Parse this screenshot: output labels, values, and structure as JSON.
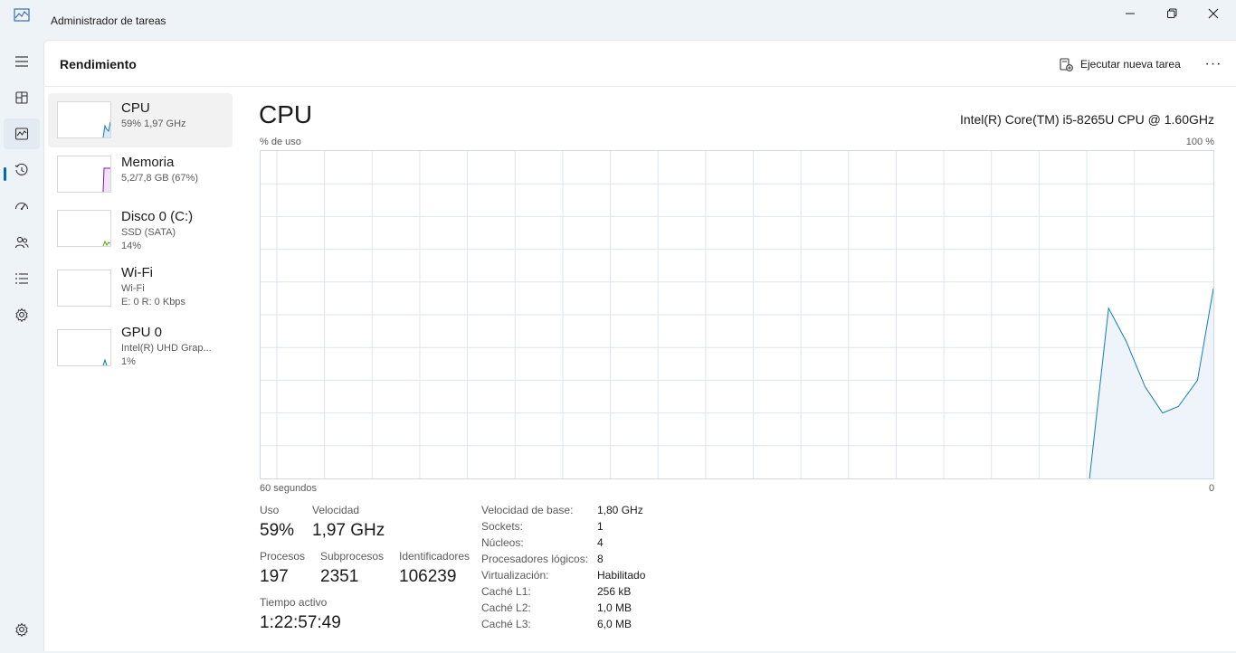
{
  "window": {
    "title": "Administrador de tareas"
  },
  "header": {
    "title": "Rendimiento",
    "run_task_label": "Ejecutar nueva tarea",
    "more_label": "···"
  },
  "nav": {
    "items": [
      "menu-icon",
      "processes-icon",
      "performance-icon",
      "history-icon",
      "startup-icon",
      "users-icon",
      "details-icon",
      "services-icon",
      "settings-icon"
    ],
    "active": "performance-icon"
  },
  "resources": [
    {
      "name": "CPU",
      "sub1": "59%  1,97 GHz",
      "sub2": "",
      "color": "#117dbb"
    },
    {
      "name": "Memoria",
      "sub1": "5,2/7,8 GB (67%)",
      "sub2": "",
      "color": "#8b12ae"
    },
    {
      "name": "Disco 0 (C:)",
      "sub1": "SSD (SATA)",
      "sub2": "14%",
      "color": "#4da60c"
    },
    {
      "name": "Wi-Fi",
      "sub1": "Wi-Fi",
      "sub2": "E: 0 R: 0 Kbps",
      "color": "#a74f01"
    },
    {
      "name": "GPU 0",
      "sub1": "Intel(R) UHD Grap...",
      "sub2": "1%",
      "color": "#0f7ea4"
    }
  ],
  "cpu": {
    "title": "CPU",
    "model": "Intel(R) Core(TM) i5-8265U CPU @ 1.60GHz",
    "usage_label": "% de uso",
    "max_label": "100 %",
    "time_label": "60 segundos",
    "zero_label": "0"
  },
  "chart_data": {
    "type": "area",
    "title": "% de uso",
    "x": [
      60,
      3,
      2,
      1.5,
      1,
      0.5,
      0
    ],
    "values": [
      0,
      52,
      42,
      28,
      20,
      30,
      58
    ],
    "ylim": [
      0,
      100
    ],
    "xlabel": "60 segundos",
    "grid": true,
    "color": "#117dbb"
  },
  "stats": {
    "uso_label": "Uso",
    "uso_value": "59%",
    "velocidad_label": "Velocidad",
    "velocidad_value": "1,97 GHz",
    "procesos_label": "Procesos",
    "procesos_value": "197",
    "subprocesos_label": "Subprocesos",
    "subprocesos_value": "2351",
    "identificadores_label": "Identificadores",
    "identificadores_value": "106239",
    "tiempo_label": "Tiempo activo",
    "tiempo_value": "1:22:57:49"
  },
  "info": [
    {
      "key": "Velocidad de base:",
      "value": "1,80 GHz"
    },
    {
      "key": "Sockets:",
      "value": "1"
    },
    {
      "key": "Núcleos:",
      "value": "4"
    },
    {
      "key": "Procesadores lógicos:",
      "value": "8"
    },
    {
      "key": "Virtualización:",
      "value": "Habilitado"
    },
    {
      "key": "Caché L1:",
      "value": "256 kB"
    },
    {
      "key": "Caché L2:",
      "value": "1,0 MB"
    },
    {
      "key": "Caché L3:",
      "value": "6,0 MB"
    }
  ]
}
